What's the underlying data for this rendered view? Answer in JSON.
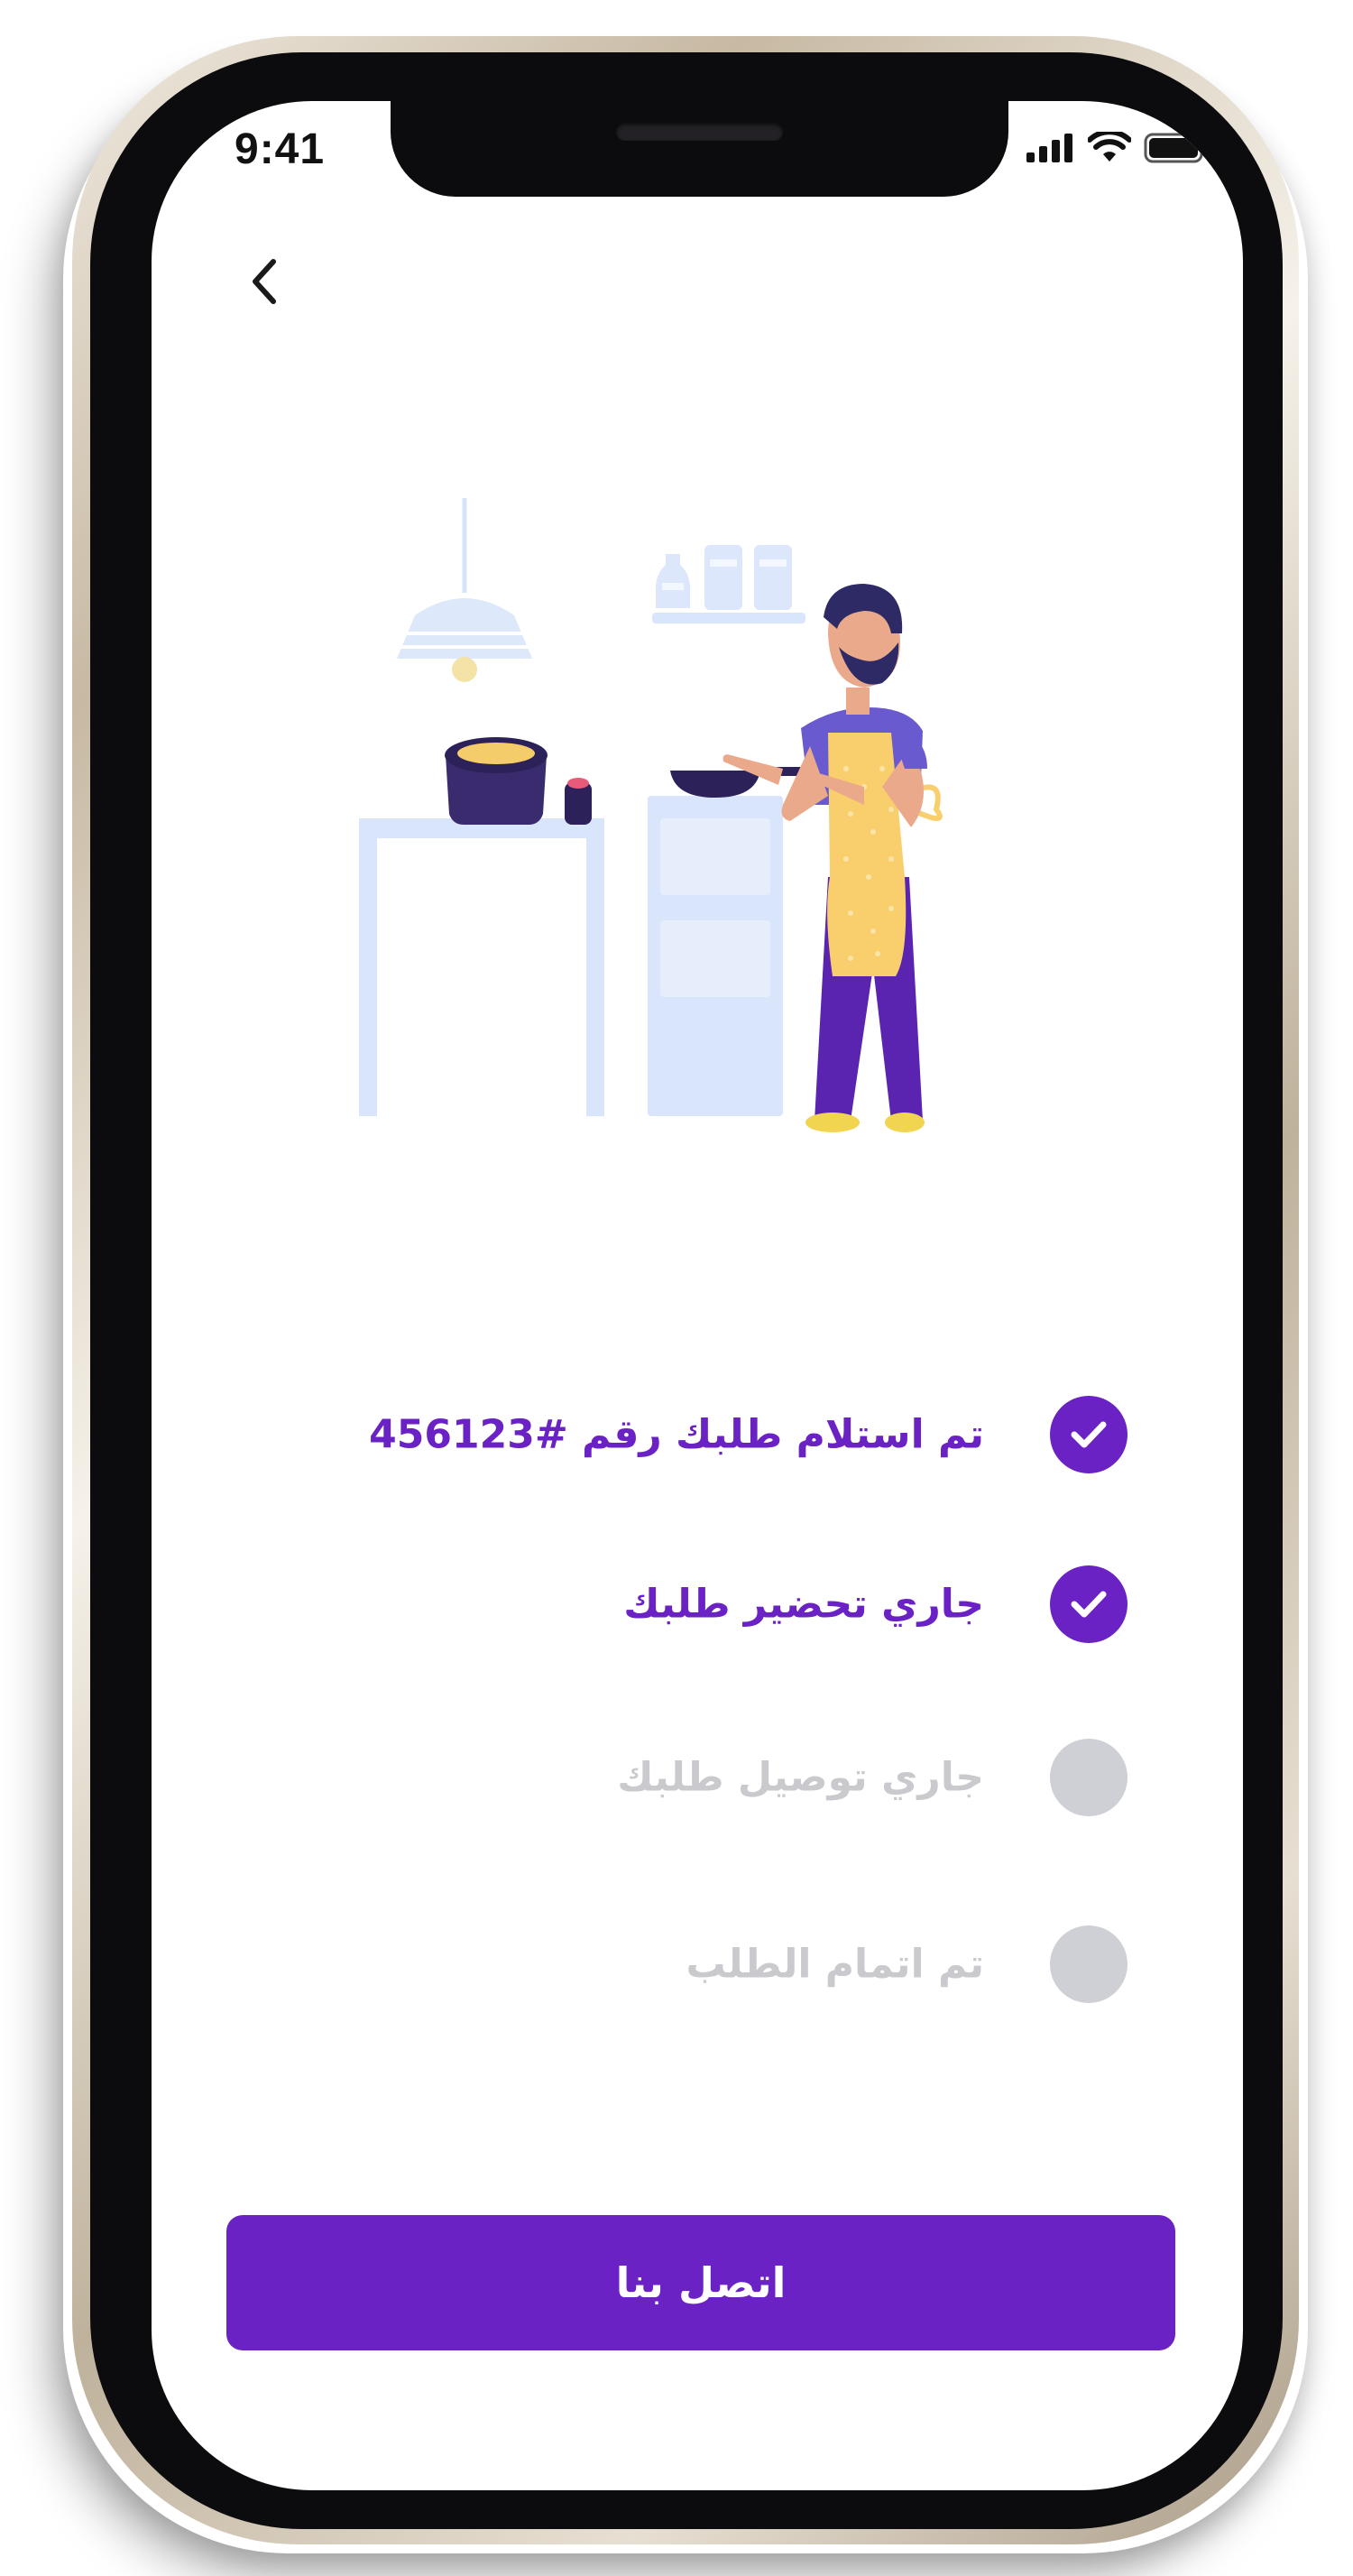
{
  "status_bar": {
    "time": "9:41"
  },
  "steps": [
    {
      "label": "تم استلام طلبك رقم #456123",
      "state": "done"
    },
    {
      "label": "جاري تحضير طلبك",
      "state": "done"
    },
    {
      "label": "جاري توصيل طلبك",
      "state": "pending"
    },
    {
      "label": "تم اتمام الطلب",
      "state": "pending"
    }
  ],
  "contact_button": {
    "label": "اتصل بنا"
  },
  "icons": {
    "back": "chevron-left-icon",
    "done": "check-icon",
    "signal": "cellular-signal-icon",
    "wifi": "wifi-icon",
    "battery": "battery-icon"
  },
  "colors": {
    "accent": "#6a22c4",
    "pending_text": "#c9c9ce",
    "pending_circle": "#cfd0d5"
  }
}
